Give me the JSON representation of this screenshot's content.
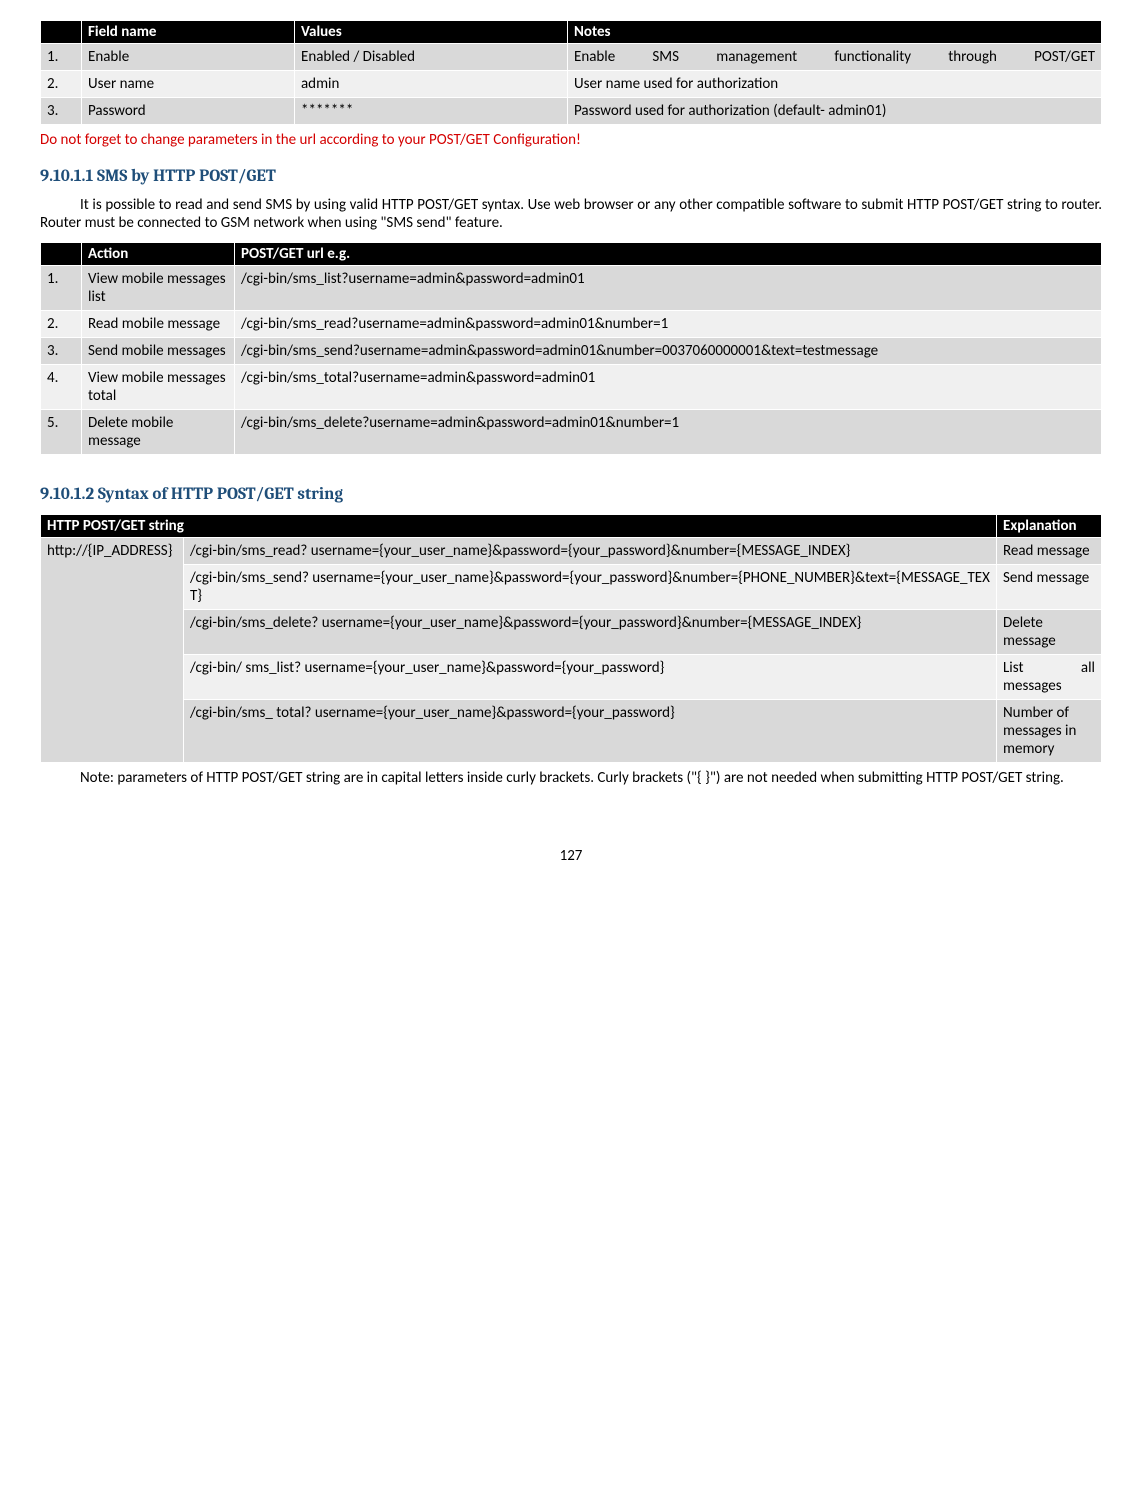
{
  "table1": {
    "headers": [
      "",
      "Field name",
      "Values",
      "Notes"
    ],
    "rows": [
      {
        "n": "1.",
        "field": "Enable",
        "values": "Enabled / Disabled",
        "notes": "Enable SMS management functionality through POST/GET"
      },
      {
        "n": "2.",
        "field": "User name",
        "values": "admin",
        "notes": "User name used for authorization"
      },
      {
        "n": "3.",
        "field": "Password",
        "values": "*******",
        "notes": "Password used for authorization (default- admin01)"
      }
    ]
  },
  "warning": "Do not forget to change parameters in the url according to your POST/GET Configuration!",
  "section1": {
    "number": "9.10.1.1",
    "title": "SMS by HTTP POST/GET",
    "paragraph": "It is possible to read and send SMS by using valid HTTP POST/GET syntax. Use web browser or any other compatible software to submit HTTP POST/GET string to router. Router must be connected to GSM network when using \"SMS send\" feature."
  },
  "table2": {
    "headers": [
      "",
      "Action",
      "POST/GET url e.g."
    ],
    "rows": [
      {
        "n": "1.",
        "action": "View mobile messages list",
        "url": "/cgi-bin/sms_list?username=admin&password=admin01"
      },
      {
        "n": "2.",
        "action": "Read mobile message",
        "url": "/cgi-bin/sms_read?username=admin&password=admin01&number=1"
      },
      {
        "n": "3.",
        "action": "Send mobile messages",
        "url": "/cgi-bin/sms_send?username=admin&password=admin01&number=0037060000001&text=testmessage"
      },
      {
        "n": "4.",
        "action": "View mobile messages total",
        "url": "/cgi-bin/sms_total?username=admin&password=admin01"
      },
      {
        "n": "5.",
        "action": "Delete mobile message",
        "url": "/cgi-bin/sms_delete?username=admin&password=admin01&number=1"
      }
    ]
  },
  "section2": {
    "number": "9.10.1.2",
    "title": "Syntax of HTTP POST/GET string"
  },
  "table3": {
    "headers": [
      "HTTP POST/GET string",
      "Explanation"
    ],
    "host": "http://{IP_ADDRESS}",
    "rows": [
      {
        "str": "/cgi-bin/sms_read? username={your_user_name}&password={your_password}&number={MESSAGE_INDEX}",
        "exp": "Read message"
      },
      {
        "str": "/cgi-bin/sms_send? username={your_user_name}&password={your_password}&number={PHONE_NUMBER}&text={MESSAGE_TEXT}",
        "exp": "Send message"
      },
      {
        "str": "/cgi-bin/sms_delete? username={your_user_name}&password={your_password}&number={MESSAGE_INDEX}",
        "exp": "Delete message"
      },
      {
        "str": "/cgi-bin/ sms_list? username={your_user_name}&password={your_password}",
        "exp": "List all messages"
      },
      {
        "str": "/cgi-bin/sms_ total? username={your_user_name}&password={your_password}",
        "exp": "Number of messages in memory"
      }
    ]
  },
  "note": "Note: parameters of HTTP POST/GET string are in capital letters inside curly brackets. Curly brackets (\"{ }\") are not needed when submitting HTTP POST/GET string.",
  "page_number": "127"
}
